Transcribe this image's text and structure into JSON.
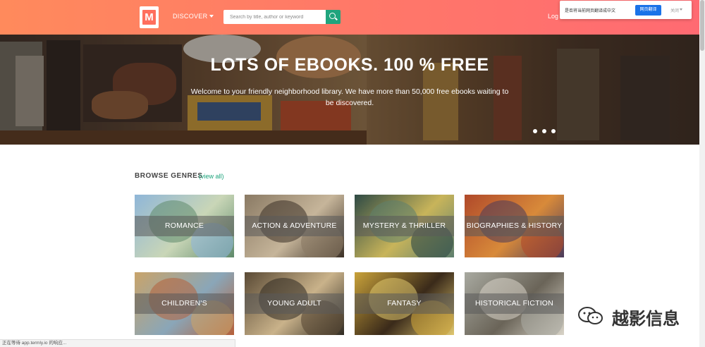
{
  "header": {
    "logo_letter": "M",
    "discover_label": "DISCOVER",
    "search_placeholder": "Search by title, author or keyword",
    "login_label": "Log"
  },
  "translate_popup": {
    "question": "是否将当前网页翻译成中文",
    "translate_button": "网页翻译",
    "close_label": "关闭"
  },
  "hero": {
    "title": "LOTS OF EBOOKS. 100 % FREE",
    "subtitle": "Welcome to your friendly neighborhood library. We have more than 50,000 free ebooks waiting to be discovered.",
    "slide_count": 3
  },
  "genres": {
    "heading": "BROWSE GENRES",
    "view_all": "(view all)",
    "items": [
      {
        "label": "ROMANCE",
        "colors": [
          "#8fb6d8",
          "#c9d6b7",
          "#5f8a6b"
        ]
      },
      {
        "label": "ACTION & ADVENTURE",
        "colors": [
          "#8a7a64",
          "#c6b59a",
          "#3b3026"
        ]
      },
      {
        "label": "MYSTERY & THRILLER",
        "colors": [
          "#2e4a45",
          "#c8b45a",
          "#5d7f6e"
        ]
      },
      {
        "label": "BIOGRAPHIES & HISTORY",
        "colors": [
          "#b0492a",
          "#d88a3a",
          "#4a3a5a"
        ]
      },
      {
        "label": "CHILDREN'S",
        "colors": [
          "#c9a46a",
          "#8aa6b8",
          "#b5603a"
        ]
      },
      {
        "label": "YOUNG ADULT",
        "colors": [
          "#5a4a35",
          "#c9b28a",
          "#2f2a22"
        ]
      },
      {
        "label": "FANTASY",
        "colors": [
          "#c9a23a",
          "#3a2a1a",
          "#e0c870"
        ]
      },
      {
        "label": "HISTORICAL FICTION",
        "colors": [
          "#a8a9a0",
          "#6a6458",
          "#d9d4c8"
        ]
      }
    ]
  },
  "status_bar": {
    "text": "正在等待 app.termly.io 的响应..."
  },
  "watermark": {
    "text": "越影信息"
  }
}
